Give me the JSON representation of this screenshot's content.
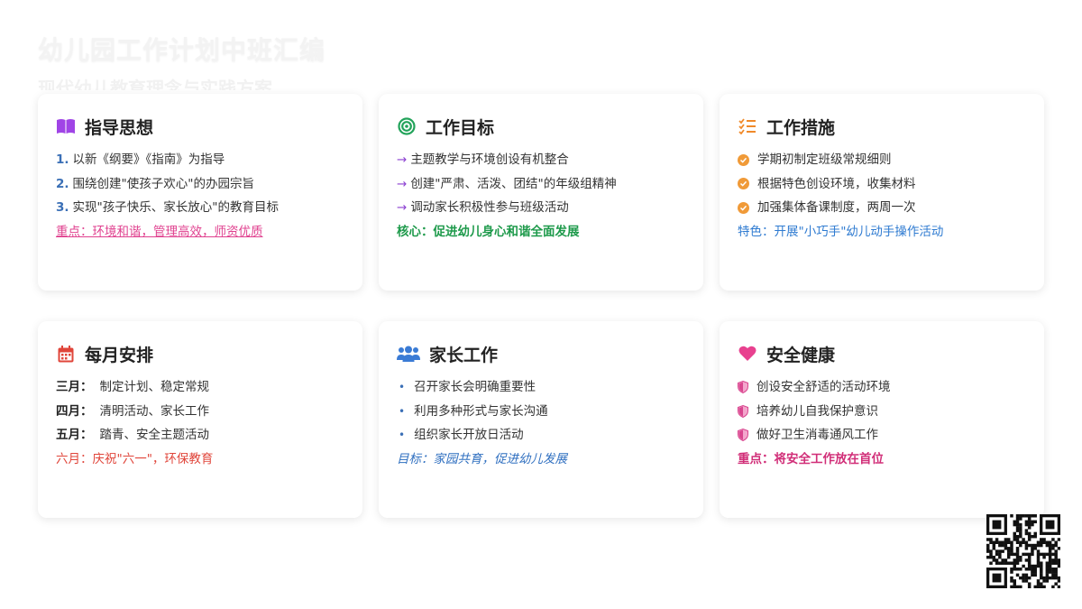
{
  "header": {
    "title": "幼儿园工作计划中班汇编",
    "subtitle": "现代幼儿教育理念与实践方案"
  },
  "cards": [
    {
      "title": "指导思想",
      "icon": "book-icon",
      "items": [
        {
          "num": "1.",
          "text": "以新《纲要》《指南》为指导"
        },
        {
          "num": "2.",
          "text": "围绕创建\"使孩子欢心\"的办园宗旨"
        },
        {
          "num": "3.",
          "text": "实现\"孩子快乐、家长放心\"的教育目标"
        }
      ],
      "note": "重点：环境和谐，管理高效，师资优质"
    },
    {
      "title": "工作目标",
      "icon": "target-icon",
      "items": [
        {
          "text": "主题教学与环境创设有机整合"
        },
        {
          "text": "创建\"严肃、活泼、团结\"的年级组精神"
        },
        {
          "text": "调动家长积极性参与班级活动"
        }
      ],
      "note": "核心：促进幼儿身心和谐全面发展"
    },
    {
      "title": "工作措施",
      "icon": "checklist-icon",
      "items": [
        {
          "text": "学期初制定班级常规细则"
        },
        {
          "text": "根据特色创设环境，收集材料"
        },
        {
          "text": "加强集体备课制度，两周一次"
        }
      ],
      "note": "特色：开展\"小巧手\"幼儿动手操作活动"
    },
    {
      "title": "每月安排",
      "icon": "calendar-icon",
      "items": [
        {
          "month": "三月：",
          "text": "制定计划、稳定常规"
        },
        {
          "month": "四月：",
          "text": "清明活动、家长工作"
        },
        {
          "month": "五月：",
          "text": "踏青、安全主题活动"
        }
      ],
      "note": "六月：庆祝\"六一\"，环保教育"
    },
    {
      "title": "家长工作",
      "icon": "users-icon",
      "items": [
        {
          "text": "召开家长会明确重要性"
        },
        {
          "text": "利用多种形式与家长沟通"
        },
        {
          "text": "组织家长开放日活动"
        }
      ],
      "note": "目标：家园共育，促进幼儿发展"
    },
    {
      "title": "安全健康",
      "icon": "heart-icon",
      "items": [
        {
          "text": "创设安全舒适的活动环境"
        },
        {
          "text": "培养幼儿自我保护意识"
        },
        {
          "text": "做好卫生消毒通风工作"
        }
      ],
      "note": "重点：将安全工作放在首位"
    }
  ],
  "colors": {
    "book": "#a044e6",
    "target": "#22a35a",
    "checklist": "#f08a2a",
    "calendar": "#e0453a",
    "users": "#3a7bd5",
    "heart": "#e8418f"
  }
}
